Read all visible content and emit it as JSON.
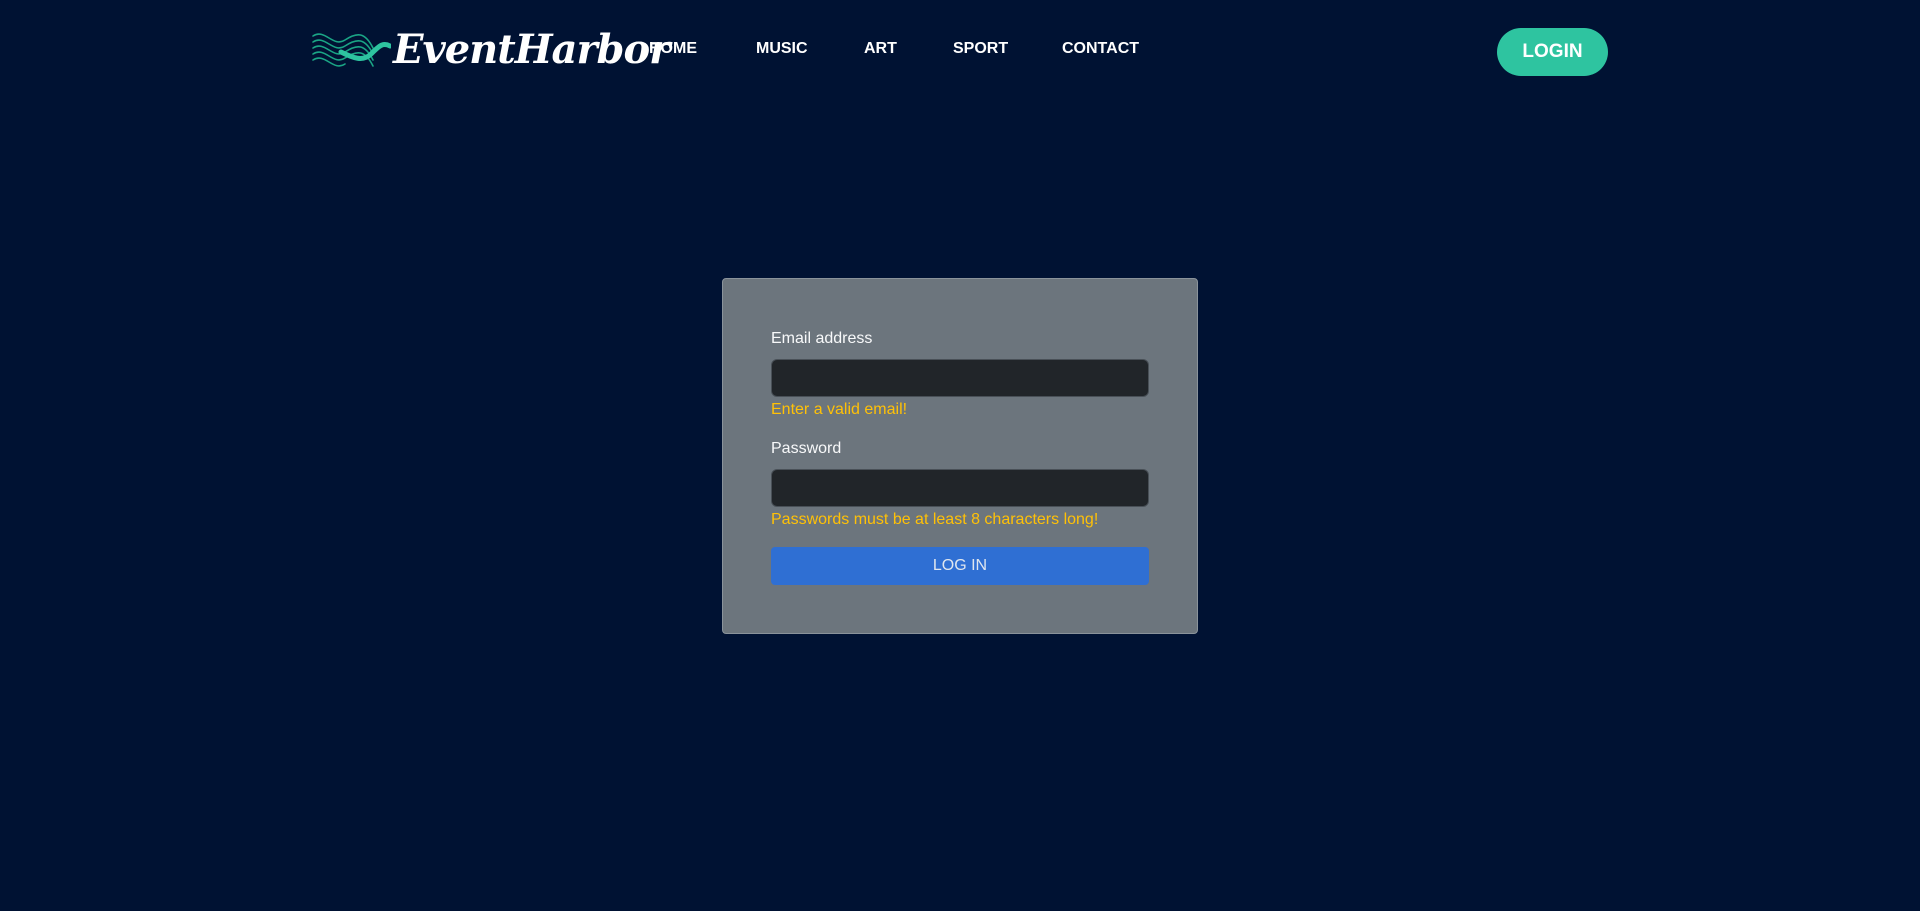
{
  "header": {
    "brand_name": "EventHarbor",
    "brand_icon": "wave-logo-icon",
    "nav": [
      {
        "label": "HOME"
      },
      {
        "label": "MUSIC"
      },
      {
        "label": "ART"
      },
      {
        "label": "SPORT"
      },
      {
        "label": "CONTACT"
      }
    ],
    "login_label": "LOGIN"
  },
  "login_form": {
    "email_label": "Email address",
    "email_value": "",
    "email_error": "Enter a valid email!",
    "password_label": "Password",
    "password_value": "",
    "password_error": "Passwords must be at least 8 characters long!",
    "submit_label": "LOG IN"
  },
  "colors": {
    "background": "#001233",
    "accent": "#2ec4a0",
    "card": "#6c757d",
    "error": "#ffc107",
    "primary": "#2f6fd3"
  }
}
